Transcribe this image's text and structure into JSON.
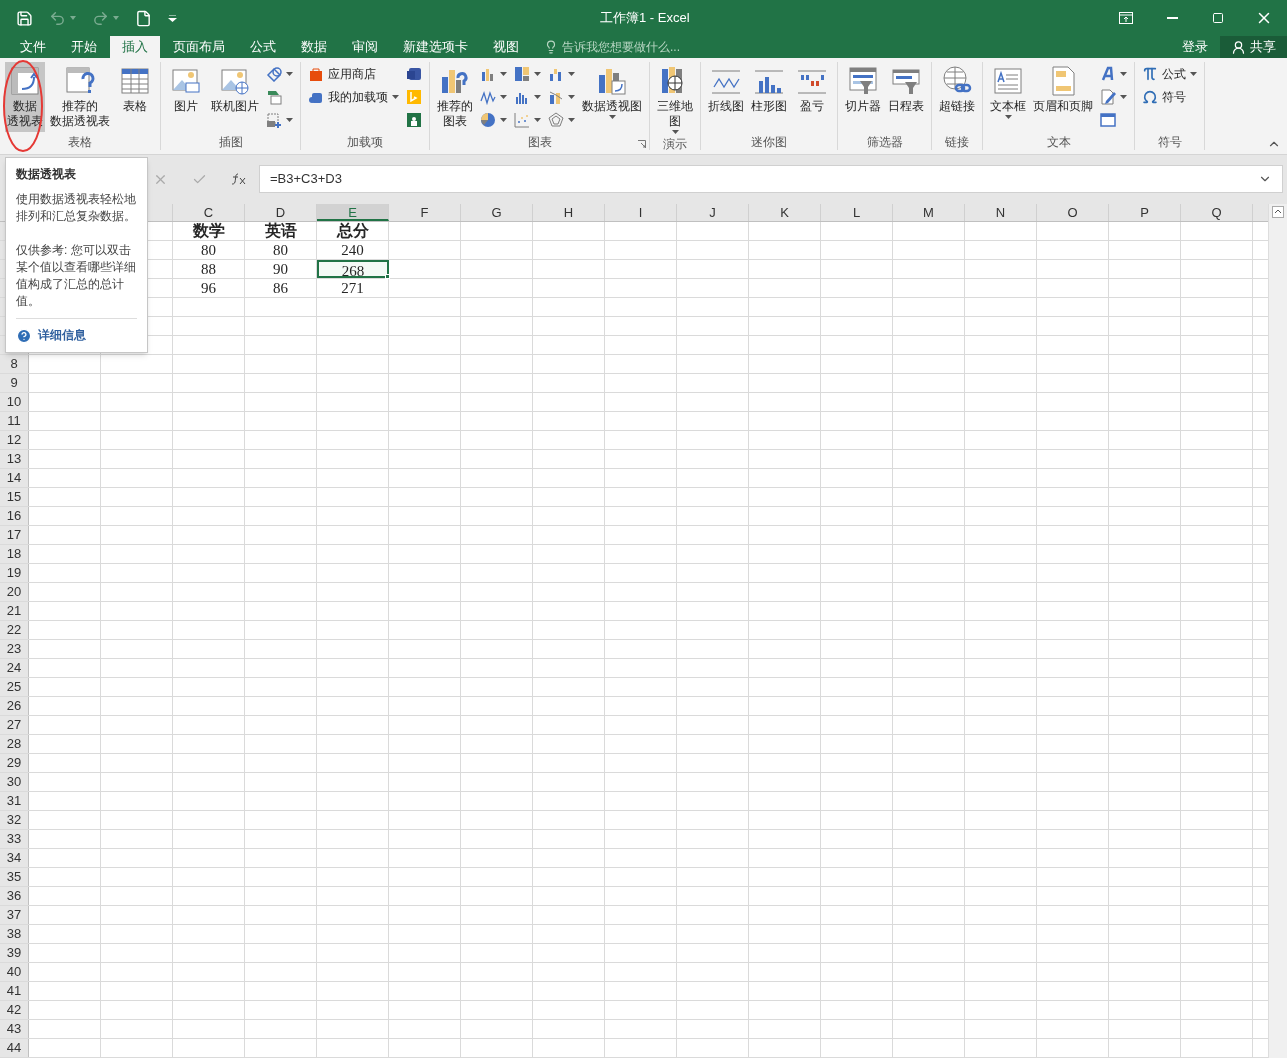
{
  "title_bar": {
    "title": "工作簿1 - Excel",
    "quick_access": [
      {
        "kind": "save",
        "disabled": false,
        "dropdown": false
      },
      {
        "kind": "undo",
        "disabled": true,
        "dropdown": true
      },
      {
        "kind": "redo",
        "disabled": true,
        "dropdown": true
      },
      {
        "kind": "new",
        "disabled": false,
        "dropdown": false
      },
      {
        "kind": "customize",
        "disabled": false,
        "dropdown": false
      }
    ]
  },
  "tabs": [
    {
      "label": "文件",
      "selected": false
    },
    {
      "label": "开始",
      "selected": false
    },
    {
      "label": "插入",
      "selected": true
    },
    {
      "label": "页面布局",
      "selected": false
    },
    {
      "label": "公式",
      "selected": false
    },
    {
      "label": "数据",
      "selected": false
    },
    {
      "label": "审阅",
      "selected": false
    },
    {
      "label": "新建选项卡",
      "selected": false
    },
    {
      "label": "视图",
      "selected": false
    }
  ],
  "tell_me": {
    "placeholder": "告诉我您想要做什么..."
  },
  "sign_in": "登录",
  "share": "共享",
  "ribbon": {
    "groups": [
      {
        "label": "表格",
        "items": [
          {
            "kind": "large",
            "lines": [
              "数据",
              "透视表"
            ],
            "dropdown": false,
            "selected": true
          },
          {
            "kind": "large",
            "lines": [
              "推荐的",
              "数据透视表"
            ],
            "dropdown": false,
            "selected": false
          },
          {
            "kind": "large",
            "lines": [
              "表格"
            ],
            "dropdown": false,
            "selected": false
          }
        ]
      },
      {
        "label": "插图",
        "items": [
          {
            "kind": "large",
            "lines": [
              "图片"
            ],
            "dropdown": false,
            "selected": false
          },
          {
            "kind": "large",
            "lines": [
              "联机图片"
            ],
            "dropdown": false,
            "selected": false
          },
          {
            "kind": "small",
            "buttons": [
              {
                "dropdown": true
              },
              {
                "dropdown": false
              },
              {
                "dropdown": true
              }
            ]
          }
        ]
      },
      {
        "label": "加载项",
        "items": [
          {
            "kind": "small",
            "buttons": [
              {
                "label": "应用商店",
                "dropdown": false
              },
              {
                "label": "我的加载项",
                "dropdown": true
              }
            ]
          },
          {
            "kind": "small",
            "buttons": [
              {
                "dropdown": false
              },
              {
                "dropdown": false
              },
              {
                "dropdown": false
              }
            ]
          }
        ]
      },
      {
        "label": "图表",
        "launcher": true,
        "items": [
          {
            "kind": "large",
            "lines": [
              "推荐的",
              "图表"
            ],
            "dropdown": false,
            "selected": false
          },
          {
            "kind": "small",
            "buttons": [
              {
                "dropdown": true
              },
              {
                "dropdown": true
              },
              {
                "dropdown": true
              }
            ]
          },
          {
            "kind": "small",
            "buttons": [
              {
                "dropdown": true
              },
              {
                "dropdown": true
              },
              {
                "dropdown": true
              }
            ]
          },
          {
            "kind": "small",
            "buttons": [
              {
                "dropdown": true
              },
              {
                "dropdown": true
              },
              {
                "dropdown": true
              }
            ]
          },
          {
            "kind": "large",
            "lines": [
              "数据透视图"
            ],
            "dropdown": true,
            "selected": false
          }
        ]
      },
      {
        "label": "演示",
        "items": [
          {
            "kind": "large",
            "lines": [
              "三维地",
              "图"
            ],
            "dropdown": true,
            "selected": false
          }
        ]
      },
      {
        "label": "迷你图",
        "items": [
          {
            "kind": "large",
            "lines": [
              "折线图"
            ],
            "dropdown": false,
            "selected": false
          },
          {
            "kind": "large",
            "lines": [
              "柱形图"
            ],
            "dropdown": false,
            "selected": false
          },
          {
            "kind": "large",
            "lines": [
              "盈亏"
            ],
            "dropdown": false,
            "selected": false
          }
        ]
      },
      {
        "label": "筛选器",
        "items": [
          {
            "kind": "large",
            "lines": [
              "切片器"
            ],
            "dropdown": false,
            "selected": false
          },
          {
            "kind": "large",
            "lines": [
              "日程表"
            ],
            "dropdown": false,
            "selected": false
          }
        ]
      },
      {
        "label": "链接",
        "items": [
          {
            "kind": "large",
            "lines": [
              "超链接"
            ],
            "dropdown": false,
            "selected": false
          }
        ]
      },
      {
        "label": "文本",
        "items": [
          {
            "kind": "large",
            "lines": [
              "文本框"
            ],
            "dropdown": true,
            "selected": false
          },
          {
            "kind": "large",
            "lines": [
              "页眉和页脚"
            ],
            "dropdown": false,
            "selected": false
          },
          {
            "kind": "small",
            "buttons": [
              {
                "dropdown": true
              },
              {
                "dropdown": true
              },
              {
                "dropdown": false
              }
            ]
          }
        ]
      },
      {
        "label": "符号",
        "items": [
          {
            "kind": "small",
            "buttons": [
              {
                "label": "公式",
                "dropdown": true
              },
              {
                "label": "符号",
                "dropdown": false
              }
            ]
          }
        ]
      }
    ]
  },
  "tooltip": {
    "title": "数据透视表",
    "description": "使用数据透视表轻松地排列和汇总复杂数据。",
    "note": "仅供参考: 您可以双击某个值以查看哪些详细值构成了汇总的总计值。",
    "link": "详细信息"
  },
  "formula_bar": {
    "formula": "=B3+C3+D3"
  },
  "sheet": {
    "columns": [
      {},
      {},
      {
        "label": "C",
        "selected": false
      },
      {
        "label": "D",
        "selected": false
      },
      {
        "label": "E",
        "selected": true
      },
      {
        "label": "F",
        "selected": false
      },
      {
        "label": "G",
        "selected": false
      },
      {
        "label": "H",
        "selected": false
      },
      {
        "label": "I",
        "selected": false
      },
      {
        "label": "J",
        "selected": false
      },
      {
        "label": "K",
        "selected": false
      },
      {
        "label": "L",
        "selected": false
      },
      {
        "label": "M",
        "selected": false
      },
      {
        "label": "N",
        "selected": false
      },
      {
        "label": "O",
        "selected": false
      },
      {
        "label": "P",
        "selected": false
      },
      {
        "label": "Q",
        "selected": false
      }
    ],
    "rows": [
      {
        "cells": {
          "C": {
            "text": "数学",
            "selected": false
          },
          "D": {
            "text": "英语",
            "selected": false
          },
          "E": {
            "text": "总分",
            "selected": false
          }
        }
      },
      {
        "cells": {
          "C": {
            "text": "80",
            "selected": false
          },
          "D": {
            "text": "80",
            "selected": false
          },
          "E": {
            "text": "240",
            "selected": false
          }
        }
      },
      {
        "cells": {
          "C": {
            "text": "88",
            "selected": false
          },
          "D": {
            "text": "90",
            "selected": false
          },
          "E": {
            "text": "268",
            "selected": true
          }
        }
      },
      {
        "cells": {
          "C": {
            "text": "96",
            "selected": false
          },
          "D": {
            "text": "86",
            "selected": false
          },
          "E": {
            "text": "271",
            "selected": false
          }
        }
      },
      {},
      {},
      {},
      {
        "header": "8"
      },
      {
        "header": "9"
      },
      {
        "header": "10"
      },
      {
        "header": "11"
      },
      {
        "header": "12"
      },
      {
        "header": "13"
      },
      {
        "header": "14"
      },
      {
        "header": "15"
      },
      {
        "header": "16"
      },
      {
        "header": "17"
      },
      {
        "header": "18"
      },
      {
        "header": "19"
      },
      {
        "header": "20"
      },
      {
        "header": "21"
      },
      {
        "header": "22"
      },
      {
        "header": "23"
      },
      {
        "header": "24"
      },
      {
        "header": "25"
      },
      {
        "header": "26"
      },
      {
        "header": "27"
      },
      {
        "header": "28"
      },
      {
        "header": "29"
      },
      {
        "header": "30"
      },
      {
        "header": "31"
      },
      {
        "header": "32"
      },
      {
        "header": "33"
      },
      {
        "header": "34"
      },
      {
        "header": "35"
      },
      {
        "header": "36"
      },
      {
        "header": "37"
      },
      {
        "header": "38"
      },
      {
        "header": "39"
      },
      {
        "header": "40"
      },
      {
        "header": "41"
      },
      {
        "header": "42"
      },
      {
        "header": "43"
      },
      {
        "header": "44"
      }
    ]
  }
}
